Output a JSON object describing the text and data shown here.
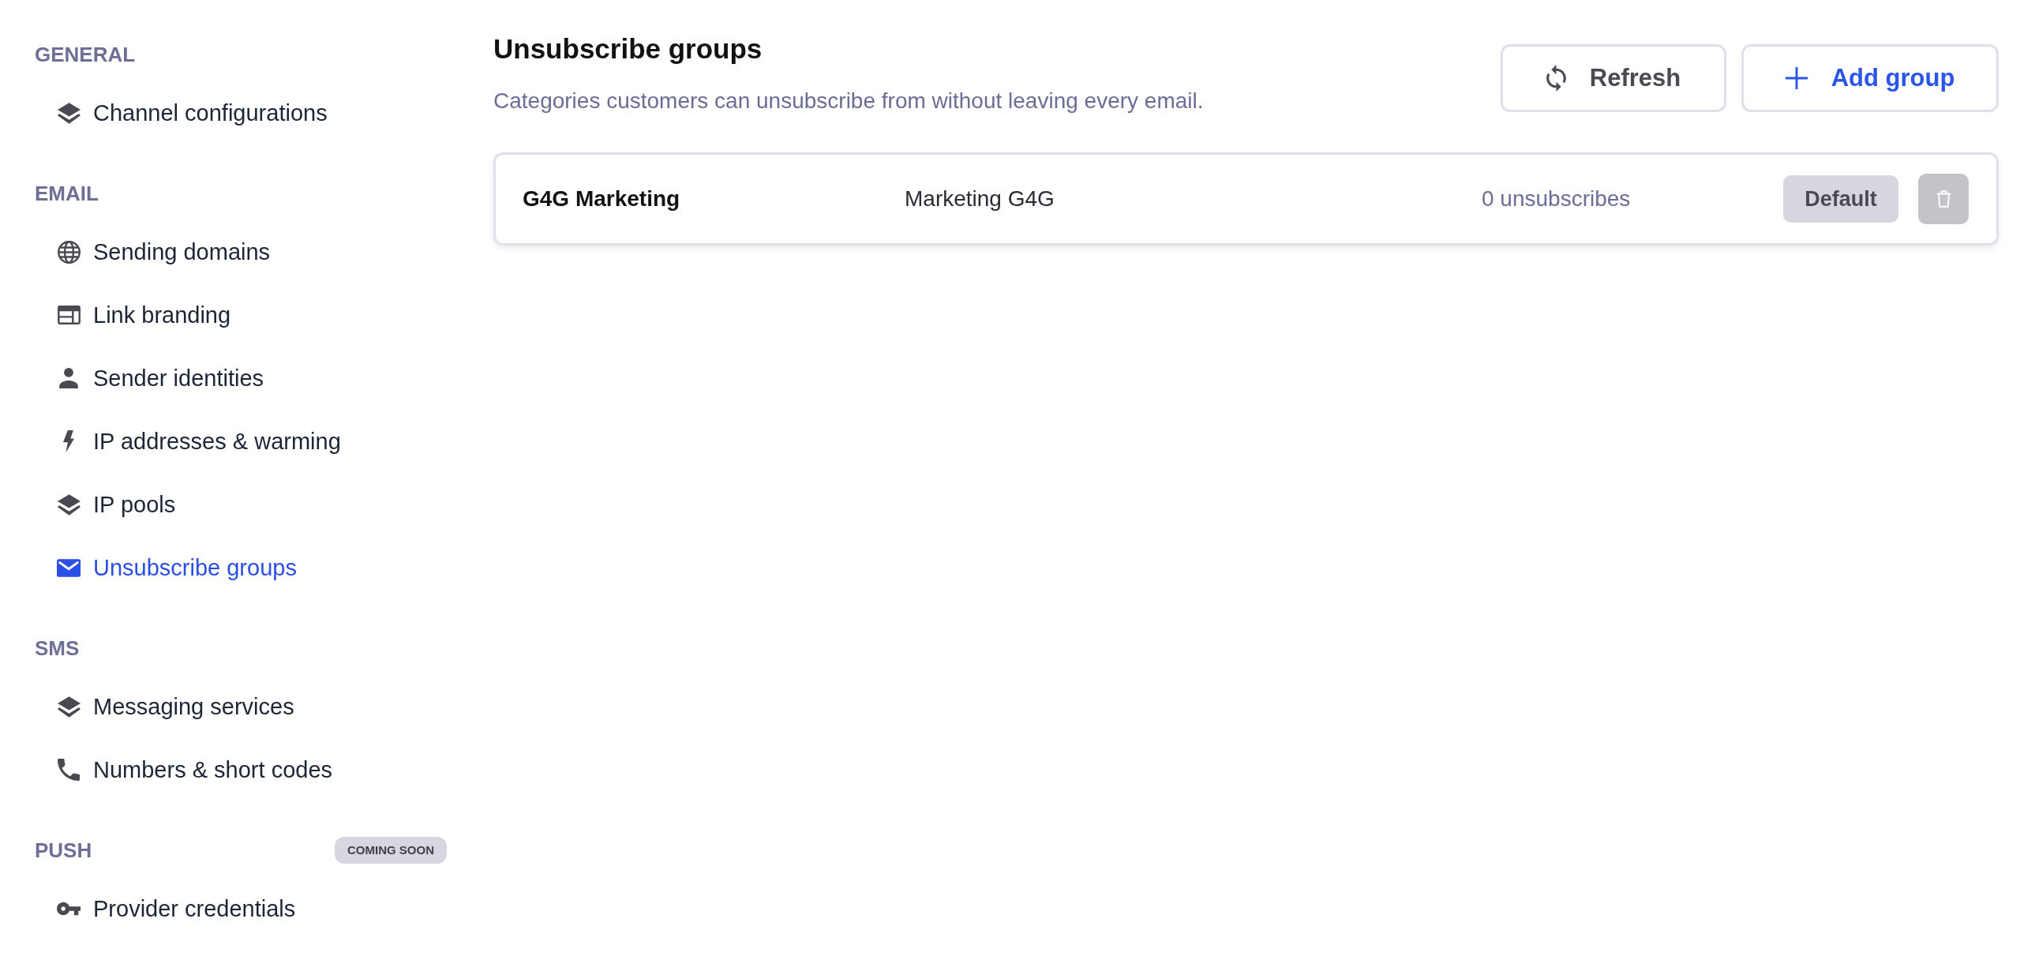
{
  "sidebar": {
    "sections": [
      {
        "title": "GENERAL",
        "items": [
          {
            "label": "Channel configurations",
            "selected": false
          }
        ]
      },
      {
        "title": "EMAIL",
        "items": [
          {
            "label": "Sending domains",
            "selected": false
          },
          {
            "label": "Link branding",
            "selected": false
          },
          {
            "label": "Sender identities",
            "selected": false
          },
          {
            "label": "IP addresses & warming",
            "selected": false
          },
          {
            "label": "IP pools",
            "selected": false
          },
          {
            "label": "Unsubscribe groups",
            "selected": true
          }
        ]
      },
      {
        "title": "SMS",
        "items": [
          {
            "label": "Messaging services",
            "selected": false
          },
          {
            "label": "Numbers & short codes",
            "selected": false
          }
        ]
      },
      {
        "title": "PUSH",
        "badge": "COMING SOON",
        "items": [
          {
            "label": "Provider credentials",
            "selected": false
          }
        ]
      }
    ]
  },
  "page": {
    "title": "Unsubscribe groups",
    "description": "Categories customers can unsubscribe from without leaving every email.",
    "buttons": [
      {
        "label": "Refresh",
        "kind": "secondary"
      },
      {
        "label": "Add group",
        "kind": "primary"
      }
    ]
  },
  "groups": [
    {
      "name": "G4G Marketing",
      "description": "Marketing G4G",
      "unsubscribes": "0 unsubscribes",
      "badge": "Default",
      "delete_disabled": true
    }
  ]
}
